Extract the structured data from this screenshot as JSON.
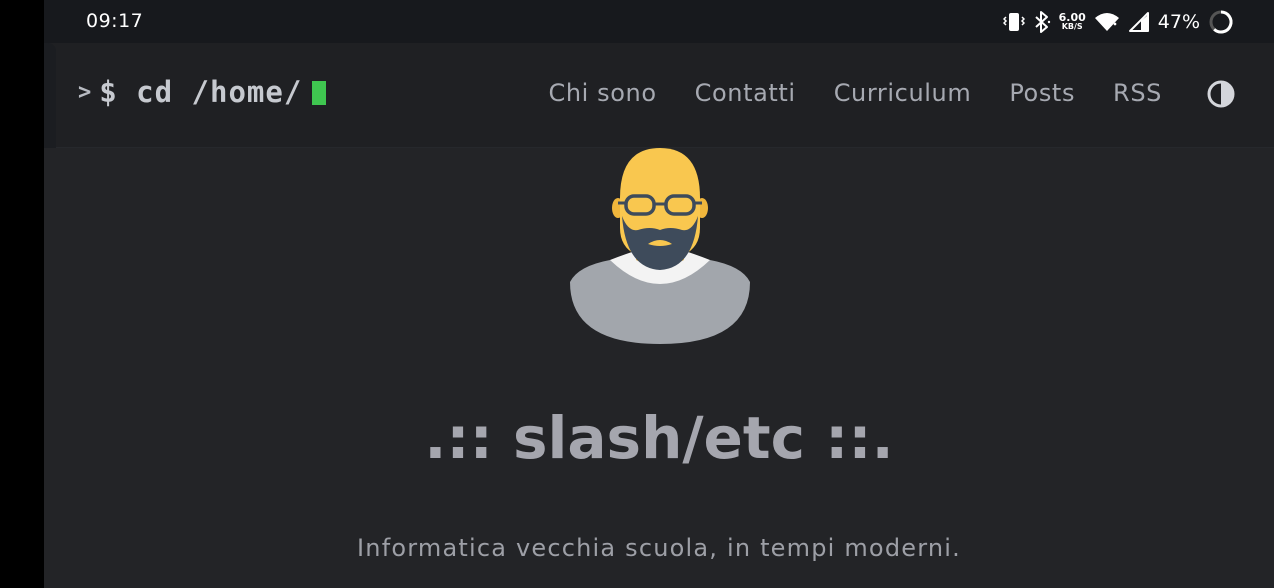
{
  "status_bar": {
    "time": "09:17",
    "net_speed_value": "6.00",
    "net_speed_unit": "KB/S",
    "battery_percent": "47%",
    "icons": [
      "vibrate-icon",
      "bluetooth-icon",
      "wifi-icon",
      "cell-signal-icon",
      "battery-ring-icon"
    ]
  },
  "header": {
    "prompt_symbol": ">",
    "prompt_command": "$ cd /home/",
    "cursor_color": "#3fc650",
    "nav": {
      "about": "Chi sono",
      "contacts": "Contatti",
      "curriculum": "Curriculum",
      "posts": "Posts",
      "rss": "RSS"
    },
    "theme_toggle_icon": "contrast-icon"
  },
  "main": {
    "avatar_icon": "bald-bearded-man-avatar",
    "title": ".:: slash/etc ::.",
    "tagline": "Informatica vecchia scuola, in tempi moderni."
  },
  "colors": {
    "background": "#232427",
    "header_bg": "#1f2023",
    "text_muted": "#a5a6ae",
    "accent_green": "#3fc650",
    "avatar_skin": "#f9c74f"
  }
}
